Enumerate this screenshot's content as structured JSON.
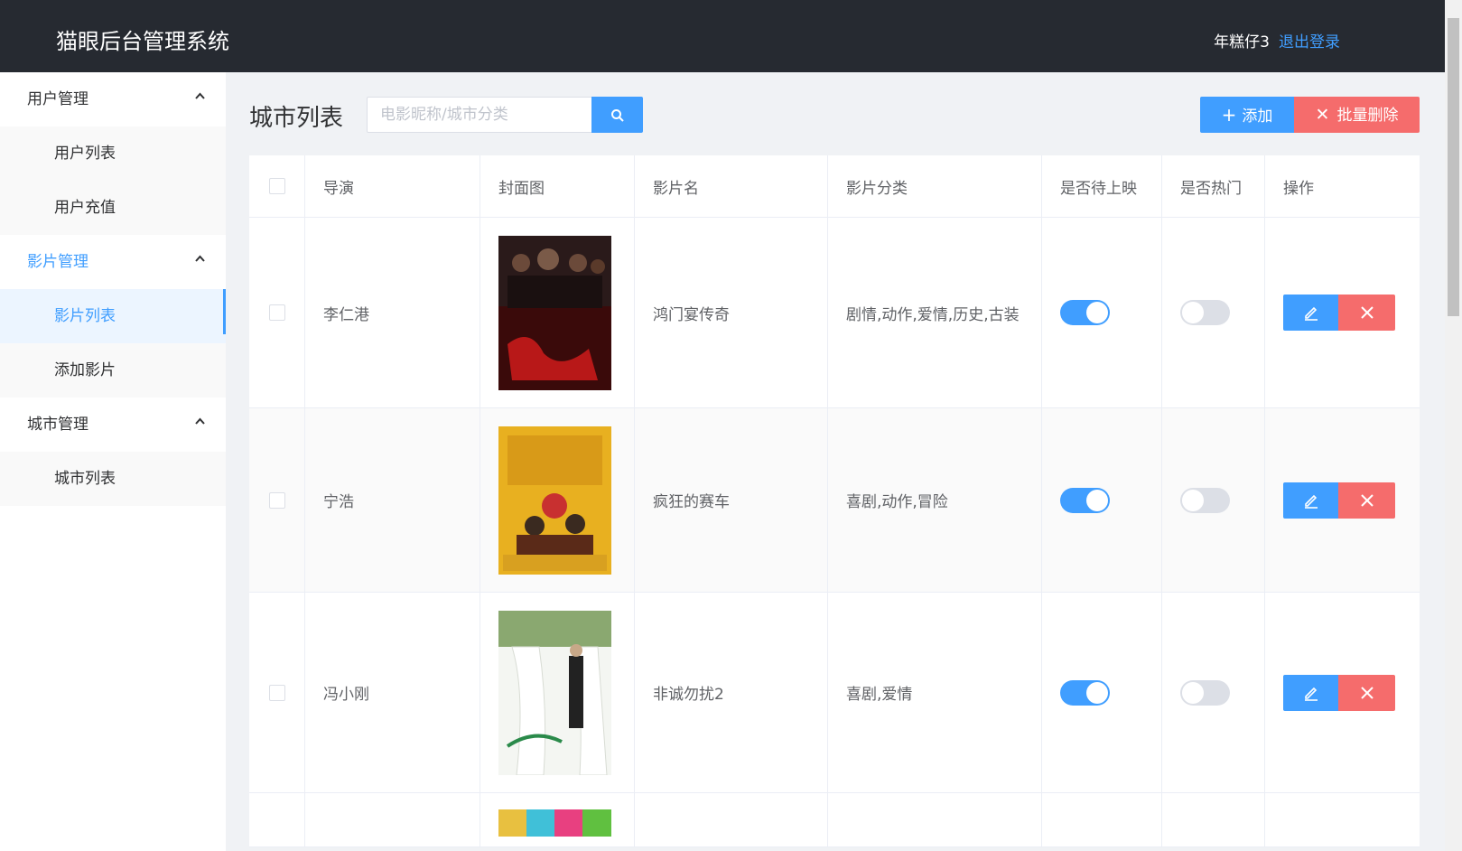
{
  "header": {
    "app_title": "猫眼后台管理系统",
    "username": "年糕仔3",
    "logout_label": "退出登录"
  },
  "sidebar": {
    "groups": [
      {
        "title": "用户管理",
        "items": [
          "用户列表",
          "用户充值"
        ]
      },
      {
        "title": "影片管理",
        "items": [
          "影片列表",
          "添加影片"
        ]
      },
      {
        "title": "城市管理",
        "items": [
          "城市列表"
        ]
      }
    ],
    "active_item": "影片列表"
  },
  "toolbar": {
    "page_title": "城市列表",
    "search_placeholder": "电影昵称/城市分类",
    "add_label": "添加",
    "batch_delete_label": "批量删除"
  },
  "table": {
    "columns": [
      "导演",
      "封面图",
      "影片名",
      "影片分类",
      "是否待上映",
      "是否热门",
      "操作"
    ],
    "rows": [
      {
        "director": "李仁港",
        "title": "鸿门宴传奇",
        "category": "剧情,动作,爱情,历史,古装",
        "upcoming": true,
        "hot": false
      },
      {
        "director": "宁浩",
        "title": "疯狂的赛车",
        "category": "喜剧,动作,冒险",
        "upcoming": true,
        "hot": false
      },
      {
        "director": "冯小刚",
        "title": "非诚勿扰2",
        "category": "喜剧,爱情",
        "upcoming": true,
        "hot": false
      }
    ]
  },
  "colors": {
    "primary": "#409eff",
    "danger": "#f56c6c",
    "header_bg": "#262a31"
  }
}
